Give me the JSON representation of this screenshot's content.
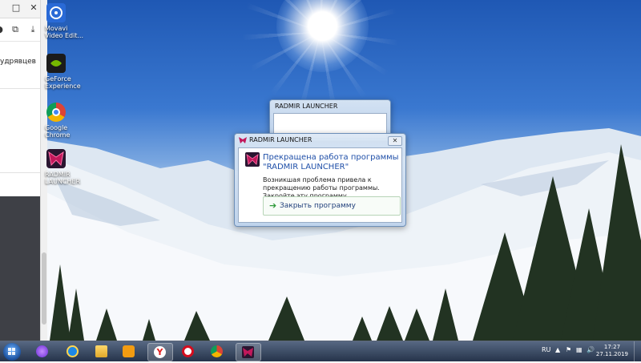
{
  "browser": {
    "visible_name": "удрявцев"
  },
  "desktop_icons": [
    {
      "label": "Movavi\nVideo Edit..."
    },
    {
      "label": "GeForce\nExperience"
    },
    {
      "label": "Google\nChrome"
    },
    {
      "label": "RADMIR\nLAUNCHER"
    }
  ],
  "background_window": {
    "title": "RADMIR LAUNCHER"
  },
  "error_dialog": {
    "title": "RADMIR LAUNCHER",
    "headline_line1": "Прекращена работа программы",
    "headline_line2": "\"RADMIR LAUNCHER\"",
    "description": "Возникшая проблема привела к прекращению работы программы. Закройте эту программу.",
    "close_button": "Закрыть программу"
  },
  "taskbar": {
    "language": "RU",
    "time": "17:27",
    "date": "27.11.2019"
  },
  "colors": {
    "headline": "#1f4fa8",
    "yandex": "#e02020",
    "opera": "#d40d1f",
    "accent_green": "#2f9a3a"
  },
  "icons": [
    "maximize-icon",
    "close-icon",
    "cast-icon",
    "download-icon",
    "movavi-icon",
    "geforce-icon",
    "chrome-icon",
    "radmir-icon",
    "start-icon",
    "alice-icon",
    "ie-icon",
    "explorer-icon",
    "media-icon",
    "yandex-icon",
    "opera-icon",
    "chrome-icon",
    "radmir-icon",
    "flag-icon",
    "network-icon",
    "volume-icon"
  ]
}
